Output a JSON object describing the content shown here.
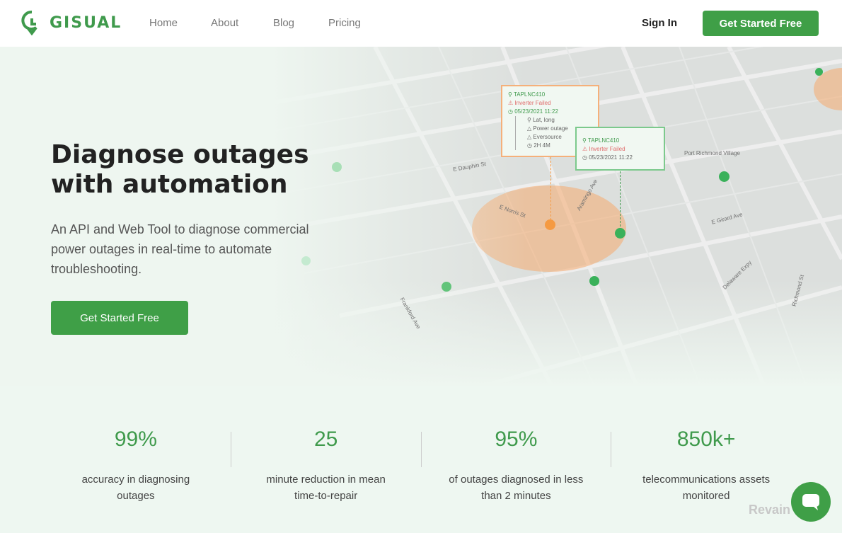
{
  "nav": {
    "brand": "GISUAL",
    "links": [
      "Home",
      "About",
      "Blog",
      "Pricing"
    ],
    "sign_in": "Sign In",
    "cta": "Get Started Free"
  },
  "hero": {
    "title": "Diagnose outages with automation",
    "subtitle": "An API and Web Tool to diagnose commercial power outages in real-time to automate troubleshooting.",
    "cta": "Get Started Free"
  },
  "map": {
    "streets": [
      "E Norris St",
      "Aramingo Ave",
      "E Girard Ave",
      "Delaware Expy",
      "Port Richmond Village",
      "Richmond St",
      "E Dauphin St",
      "Frankford Ave"
    ],
    "card1": {
      "id": "TAPLNC410",
      "status": "Inverter Failed",
      "time": "05/23/2021 11:22",
      "details": [
        "Lat, long",
        "Power outage",
        "Eversource",
        "2H 4M"
      ]
    },
    "card2": {
      "id": "TAPLNC410",
      "status": "Inverter Failed",
      "time": "05/23/2021 11:22"
    },
    "colors": {
      "primary": "#3f9a4c",
      "orange": "#f59a42",
      "alert": "#e06a6a"
    }
  },
  "stats": [
    {
      "value": "99%",
      "label": "accuracy in diagnosing outages"
    },
    {
      "value": "25",
      "label": "minute reduction in mean time-to-repair"
    },
    {
      "value": "95%",
      "label": "of outages diagnosed in less than 2 minutes"
    },
    {
      "value": "850k+",
      "label": "telecommunications assets monitored"
    }
  ],
  "watermark": "Revain"
}
